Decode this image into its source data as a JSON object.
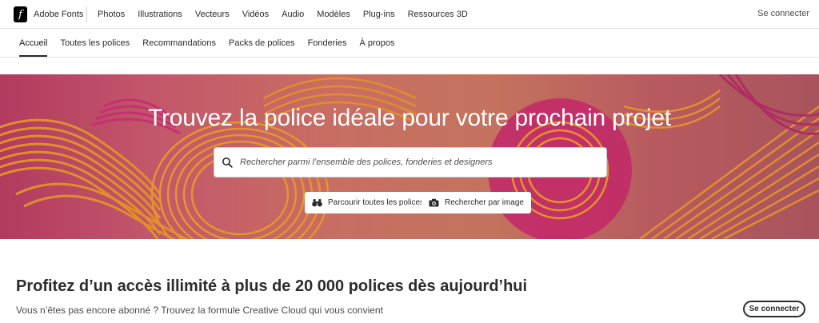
{
  "brand": {
    "name": "Adobe Fonts",
    "logo_glyph": "f"
  },
  "topnav": {
    "items": [
      "Photos",
      "Illustrations",
      "Vecteurs",
      "Vidéos",
      "Audio",
      "Modèles",
      "Plug-ins",
      "Ressources 3D"
    ],
    "signin": "Se connecter"
  },
  "subnav": {
    "tabs": [
      "Accueil",
      "Toutes les polices",
      "Recommandations",
      "Packs de polices",
      "Fonderies",
      "À propos"
    ],
    "active": "Accueil"
  },
  "hero": {
    "title": "Trouvez la police idéale pour votre prochain projet",
    "search_placeholder": "Rechercher parmi l’ensemble des polices, fonderies et designers",
    "browse_button": "Parcourir toutes les polices",
    "image_search_button": "Rechercher par image",
    "colors": {
      "pink": "#b8326d",
      "orange": "#d9872c",
      "magenta": "#c22a68"
    }
  },
  "promo": {
    "title": "Profitez d’un accès illimité à plus de 20 000 polices dès aujourd’hui",
    "subtitle": "Vous n’êtes pas encore abonné ? Trouvez la formule Creative Cloud qui vous convient",
    "signin_button": "Se connecter"
  }
}
